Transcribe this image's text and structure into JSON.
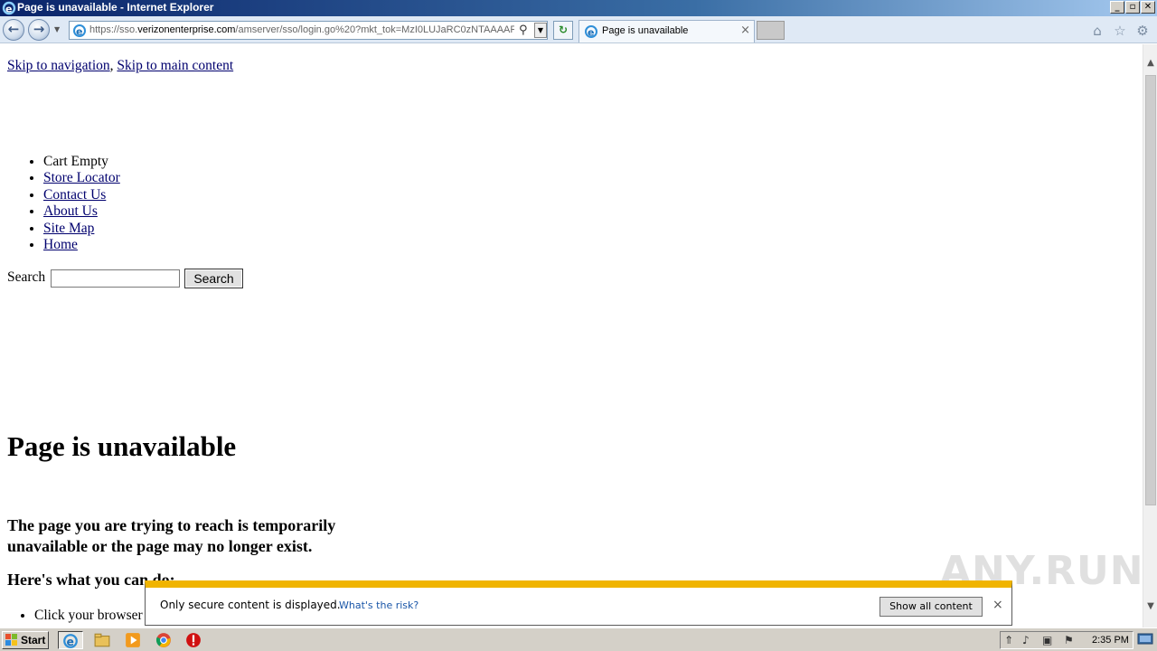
{
  "window": {
    "title": "Page is unavailable - Internet Explorer",
    "controls": {
      "minimize": "_",
      "maximize": "▫",
      "close": "✕"
    }
  },
  "navbar": {
    "back_icon": "back-arrow-icon",
    "forward_icon": "forward-arrow-icon",
    "address": {
      "url_prefix": "https://sso.",
      "url_domain": "verizonenterprise.com",
      "url_rest": "/amserver/sso/login.go%20?mkt_tok=MzI0LUJaRC0zNTAAAAF€"
    },
    "tab": {
      "label": "Page is unavailable",
      "close": "×"
    },
    "toolbar_icons": [
      "home-icon",
      "favorites-star-icon",
      "settings-gear-icon"
    ]
  },
  "page": {
    "skip_nav": "Skip to navigation",
    "skip_sep": ",",
    "skip_main": "Skip to main content",
    "nav_items": [
      {
        "label": "Cart Empty",
        "link": false
      },
      {
        "label": "Store Locator",
        "link": true
      },
      {
        "label": "Contact Us",
        "link": true
      },
      {
        "label": "About Us",
        "link": true
      },
      {
        "label": "Site Map",
        "link": true
      },
      {
        "label": "Home",
        "link": true
      }
    ],
    "search_label": "Search",
    "search_value": "",
    "search_button": "Search",
    "heading": "Page is unavailable",
    "description": "The page you are trying to reach is temporarily unavailable or the page may no longer exist.",
    "subheading": "Here's what you can do:",
    "tip_visible": "Click your browser"
  },
  "notification": {
    "message": "Only secure content is displayed.",
    "risk_link": "What's the risk?",
    "show_button": "Show all content",
    "close": "×"
  },
  "watermark": "ANY.RUN",
  "taskbar": {
    "start_label": "Start",
    "apps": [
      "internet-explorer-icon",
      "file-explorer-icon",
      "media-player-icon",
      "chrome-icon",
      "stop-sign-icon"
    ],
    "tray_icons": [
      "show-hidden-icon",
      "volume-icon",
      "network-icon",
      "action-center-flag-icon"
    ],
    "clock": "2:35 PM"
  },
  "colors": {
    "link": "#00006e",
    "notification_accent": "#f0b400",
    "navbar_bg": "#dfe9f5"
  }
}
